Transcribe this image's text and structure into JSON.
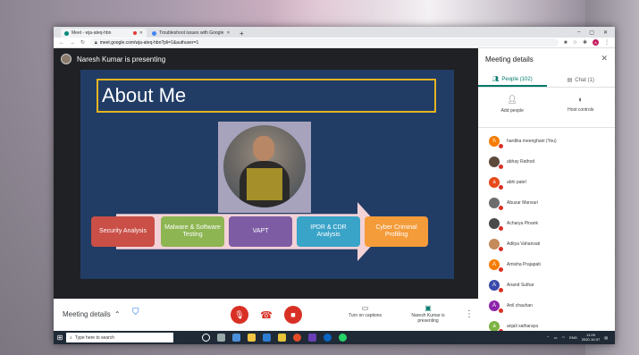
{
  "browser": {
    "tabs": [
      {
        "title": "Meet - wja-ateq-hbn"
      },
      {
        "title": "Troubleshoot issues with Google"
      }
    ],
    "new_tab": "+",
    "url": "meet.google.com/wja-ateq-hbn?pli=1&authuser=1",
    "window_controls": [
      "–",
      "▢",
      "✕"
    ],
    "profile_initial": "A"
  },
  "meet": {
    "presenter_label": "Naresh Kumar is presenting",
    "meeting_details": "Meeting details",
    "captions_label": "Turn on captions",
    "presenting_label": "Naresh Kumar is presenting"
  },
  "slide": {
    "title": "About Me",
    "boxes": [
      {
        "label": "Security Analysis",
        "color": "#c94f47"
      },
      {
        "label": "Malware & Software Testing",
        "color": "#8db552"
      },
      {
        "label": "VAPT",
        "color": "#7d5ca4"
      },
      {
        "label": "IPDR & CDR Analysis",
        "color": "#3aa3c8"
      },
      {
        "label": "Cyber Criminal Profiling",
        "color": "#f49b3a"
      }
    ]
  },
  "panel": {
    "title": "Meeting details",
    "tabs": [
      {
        "label": "People (102)",
        "active": true
      },
      {
        "label": "Chat (1)",
        "active": false
      }
    ],
    "actions": [
      {
        "label": "Add people"
      },
      {
        "label": "Host controls"
      }
    ],
    "people": [
      {
        "name": "hardika meenghani (You)",
        "initial": "h",
        "color": "#f57c00"
      },
      {
        "name": "abhay Rathod",
        "initial": "",
        "color": "#5d4a3a"
      },
      {
        "name": "abhi patel",
        "initial": "a",
        "color": "#e64a19"
      },
      {
        "name": "Abuzar Mansuri",
        "initial": "",
        "color": "#6d6d6d"
      },
      {
        "name": "Acharya Pinank",
        "initial": "",
        "color": "#4a4a4a"
      },
      {
        "name": "Aditya Vahanvati",
        "initial": "",
        "color": "#c48a5a"
      },
      {
        "name": "Amisha Prajapati",
        "initial": "A",
        "color": "#f57c00"
      },
      {
        "name": "Anand Suthar",
        "initial": "A",
        "color": "#3949ab"
      },
      {
        "name": "Anil chauhan",
        "initial": "A",
        "color": "#8e24aa"
      },
      {
        "name": "anjali satharaya",
        "initial": "a",
        "color": "#7cb342"
      }
    ]
  },
  "taskbar": {
    "search_placeholder": "Type here to search",
    "lang": "ENG",
    "time": "11:09",
    "date": "2020-10-07"
  }
}
